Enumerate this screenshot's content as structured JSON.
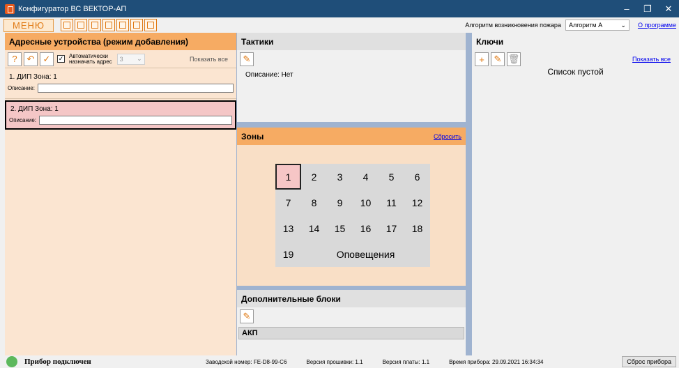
{
  "window": {
    "title": "Конфигуратор ВС ВЕКТОР-АП",
    "controls": [
      "–",
      "❐",
      "✕"
    ]
  },
  "toolbar": {
    "menu_label": "МЕНЮ",
    "icons": [
      "config-read-icon",
      "config-write-icon",
      "export-icon",
      "import-icon",
      "clock-icon",
      "list-icon",
      "info-icon"
    ],
    "algorithm_label": "Алгоритм возникновения пожара",
    "algorithm_value": "Алгоритм А",
    "about_link": "О программе"
  },
  "left": {
    "title": "Адресные устройства (режим добавления)",
    "auto_assign_label_1": "Автоматически",
    "auto_assign_label_2": "назначать адрес",
    "auto_assign_checked": true,
    "address_value": "3",
    "show_all": "Показать все",
    "devices": [
      {
        "title": "1. ДИП  Зона: 1",
        "desc_label": "Описание:",
        "desc_value": ""
      },
      {
        "title": "2. ДИП  Зона: 1",
        "desc_label": "Описание:",
        "desc_value": ""
      }
    ]
  },
  "tactics": {
    "title": "Тактики",
    "description": "Описание: Нет"
  },
  "zones": {
    "title": "Зоны",
    "reset_link": "Сбросить",
    "items": [
      "1",
      "2",
      "3",
      "4",
      "5",
      "6",
      "7",
      "8",
      "9",
      "10",
      "11",
      "12",
      "13",
      "14",
      "15",
      "16",
      "17",
      "18",
      "19"
    ],
    "alerts_label": "Оповещения",
    "active": "1"
  },
  "extra": {
    "title": "Дополнительные блоки",
    "items": [
      "АКП"
    ]
  },
  "keys": {
    "title": "Ключи",
    "show_all": "Показать все",
    "empty": "Список пустой"
  },
  "status": {
    "connection": "Прибор подключен",
    "serial": "Заводской номер: FE-D8-99-C6",
    "firmware": "Версия прошивки: 1.1",
    "board": "Версия платы: 1.1",
    "time": "Время прибора: 29.09.2021 16:34:34",
    "reset_button": "Сброс прибора"
  },
  "colors": {
    "titlebar": "#1f4e79",
    "accent_orange": "#e07a15",
    "panel_orange": "#f6ab63",
    "zone_active": "#f6c6c6",
    "connected_led": "#5cb85c"
  }
}
